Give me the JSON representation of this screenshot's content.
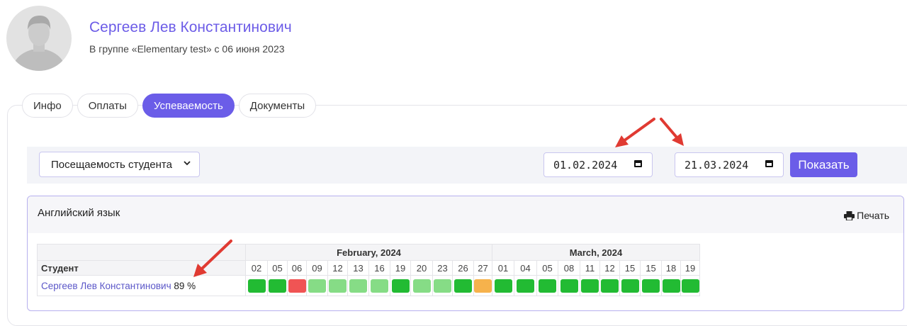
{
  "profile": {
    "name": "Сергеев Лев Константинович",
    "group_line": "В группе «Elementary test» с 06 июня 2023"
  },
  "tabs": [
    {
      "label": "Инфо",
      "active": false
    },
    {
      "label": "Оплаты",
      "active": false
    },
    {
      "label": "Успеваемость",
      "active": true
    },
    {
      "label": "Документы",
      "active": false
    }
  ],
  "filter": {
    "report_select": "Посещаемость студента",
    "date_from": "01.02.2024",
    "date_to": "21.03.2024",
    "show_button": "Показать"
  },
  "card": {
    "subject": "Английский язык",
    "print_label": "Печать"
  },
  "grid": {
    "student_header": "Студент",
    "months": [
      {
        "label": "February, 2024",
        "days": [
          "02",
          "05",
          "06",
          "09",
          "12",
          "13",
          "16",
          "19",
          "20",
          "23",
          "26",
          "27"
        ]
      },
      {
        "label": "March, 2024",
        "days": [
          "01",
          "04",
          "05",
          "08",
          "11",
          "12",
          "15",
          "15",
          "18",
          "19"
        ]
      }
    ],
    "row": {
      "student": "Сергеев Лев Константинович",
      "percent": "89 %",
      "statuses": [
        "present",
        "present",
        "absent",
        "partial",
        "partial",
        "partial",
        "partial",
        "present",
        "partial",
        "partial",
        "present",
        "late",
        "present",
        "present",
        "present",
        "present",
        "present",
        "present",
        "present",
        "present",
        "present",
        "present"
      ]
    }
  },
  "colors": {
    "accent": "#6b5de8",
    "present": "#22bb33",
    "partial": "#86dc86",
    "absent": "#f05454",
    "late": "#f6b24c",
    "arrow": "#e03a32"
  }
}
